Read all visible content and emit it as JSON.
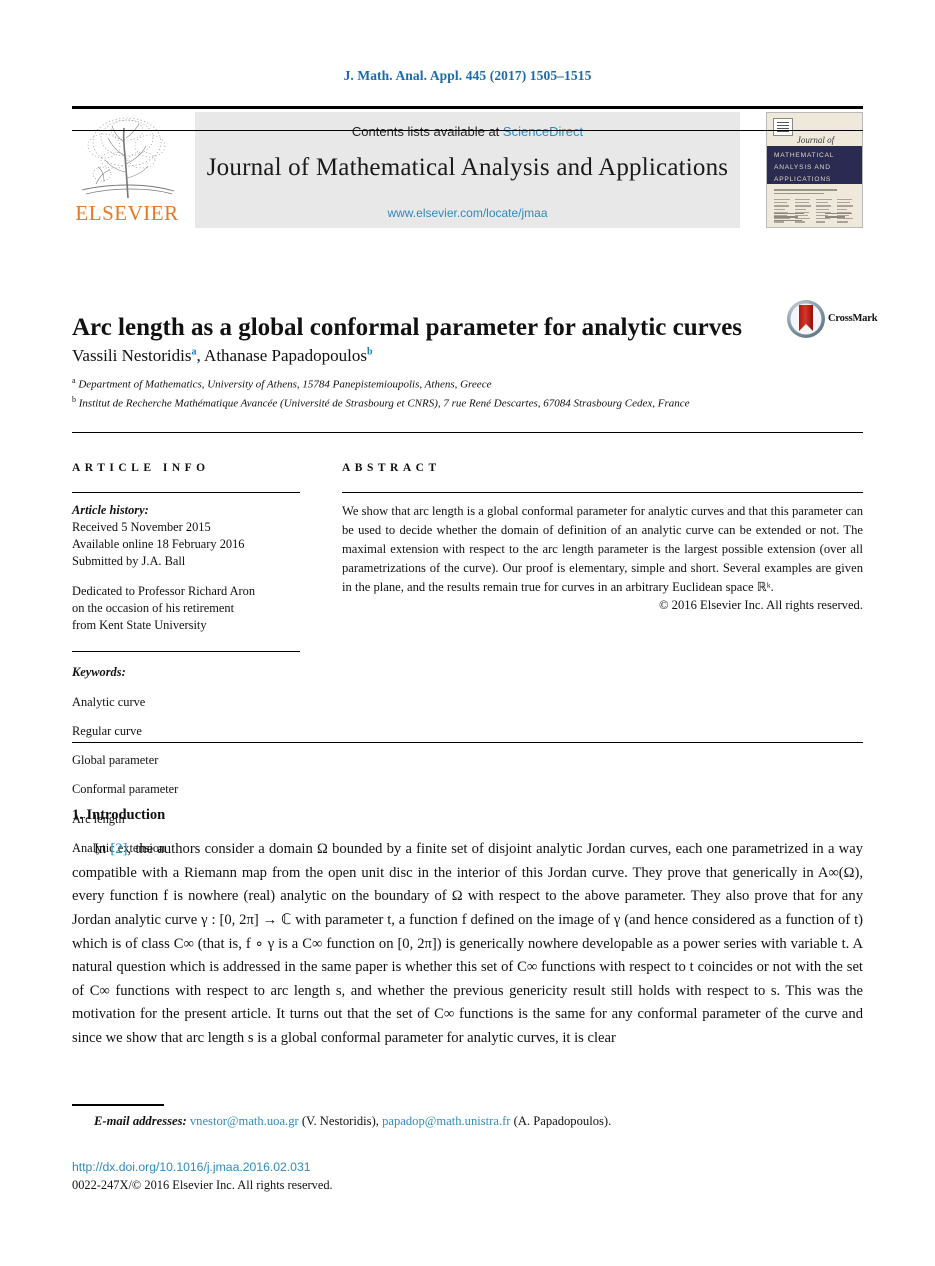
{
  "running_head": "J. Math. Anal. Appl. 445 (2017) 1505–1515",
  "masthead": {
    "contents_prefix": "Contents lists available at ",
    "sciencedirect": "ScienceDirect",
    "journal_title": "Journal of Mathematical Analysis and Applications",
    "journal_url": "www.elsevier.com/locate/jmaa",
    "publisher_wordmark": "ELSEVIER",
    "publisher_color": "#E87722",
    "link_color": "#2e8bc0",
    "cover": {
      "journal_of": "Journal of",
      "band_line1": "MATHEMATICAL",
      "band_line2": "ANALYSIS AND",
      "band_line3": "APPLICATIONS",
      "band_color": "#2b2a50",
      "paper_color": "#efe9dc"
    }
  },
  "article": {
    "title": "Arc length as a global conformal parameter for analytic curves",
    "authors": [
      {
        "name": "Vassili Nestoridis",
        "marker": "a"
      },
      {
        "name": "Athanase Papadopoulos",
        "marker": "b"
      }
    ],
    "affiliations": [
      {
        "marker": "a",
        "text": "Department of Mathematics, University of Athens, 15784 Panepistemioupolis, Athens, Greece"
      },
      {
        "marker": "b",
        "text": "Institut de Recherche Mathématique Avancée (Université de Strasbourg et CNRS), 7 rue René Descartes, 67084 Strasbourg Cedex, France"
      }
    ],
    "crossmark_label": "CrossMark"
  },
  "info": {
    "label": "ARTICLE INFO",
    "history_heading": "Article history:",
    "history": [
      "Received 5 November 2015",
      "Available online 18 February 2016",
      "Submitted by J.A. Ball"
    ],
    "dedication": [
      "Dedicated to Professor Richard Aron",
      "on the occasion of his retirement",
      "from Kent State University"
    ],
    "keywords_heading": "Keywords:",
    "keywords": [
      "Analytic curve",
      "Regular curve",
      "Global parameter",
      "Conformal parameter",
      "Arc length",
      "Analytic extension"
    ]
  },
  "abstract": {
    "label": "ABSTRACT",
    "text": "We show that arc length is a global conformal parameter for analytic curves and that this parameter can be used to decide whether the domain of definition of an analytic curve can be extended or not. The maximal extension with respect to the arc length parameter is the largest possible extension (over all parametrizations of the curve). Our proof is elementary, simple and short. Several examples are given in the plane, and the results remain true for curves in an arbitrary Euclidean space ℝᵏ.",
    "copyright": "© 2016 Elsevier Inc. All rights reserved."
  },
  "body": {
    "section_heading": "1. Introduction",
    "paragraph_prefix": "In ",
    "reference_marker": "[2]",
    "paragraph": ", the authors consider a domain Ω bounded by a finite set of disjoint analytic Jordan curves, each one parametrized in a way compatible with a Riemann map from the open unit disc in the interior of this Jordan curve. They prove that generically in A∞(Ω), every function f is nowhere (real) analytic on the boundary of Ω with respect to the above parameter. They also prove that for any Jordan analytic curve γ : [0, 2π] → ℂ with parameter t, a function f defined on the image of γ (and hence considered as a function of t) which is of class C∞ (that is, f ∘ γ is a C∞ function on [0, 2π]) is generically nowhere developable as a power series with variable t. A natural question which is addressed in the same paper is whether this set of C∞ functions with respect to t coincides or not with the set of C∞ functions with respect to arc length s, and whether the previous genericity result still holds with respect to s. This was the motivation for the present article. It turns out that the set of C∞ functions is the same for any conformal parameter of the curve and since we show that arc length s is a global conformal parameter for analytic curves, it is clear"
  },
  "footer": {
    "email_label": "E-mail addresses:",
    "emails": [
      {
        "address": "vnestor@math.uoa.gr",
        "owner": "(V. Nestoridis)"
      },
      {
        "address": "papadop@math.unistra.fr",
        "owner": "(A. Papadopoulos)"
      }
    ],
    "doi": "http://dx.doi.org/10.1016/j.jmaa.2016.02.031",
    "issn_line": "0022-247X/© 2016 Elsevier Inc. All rights reserved."
  }
}
